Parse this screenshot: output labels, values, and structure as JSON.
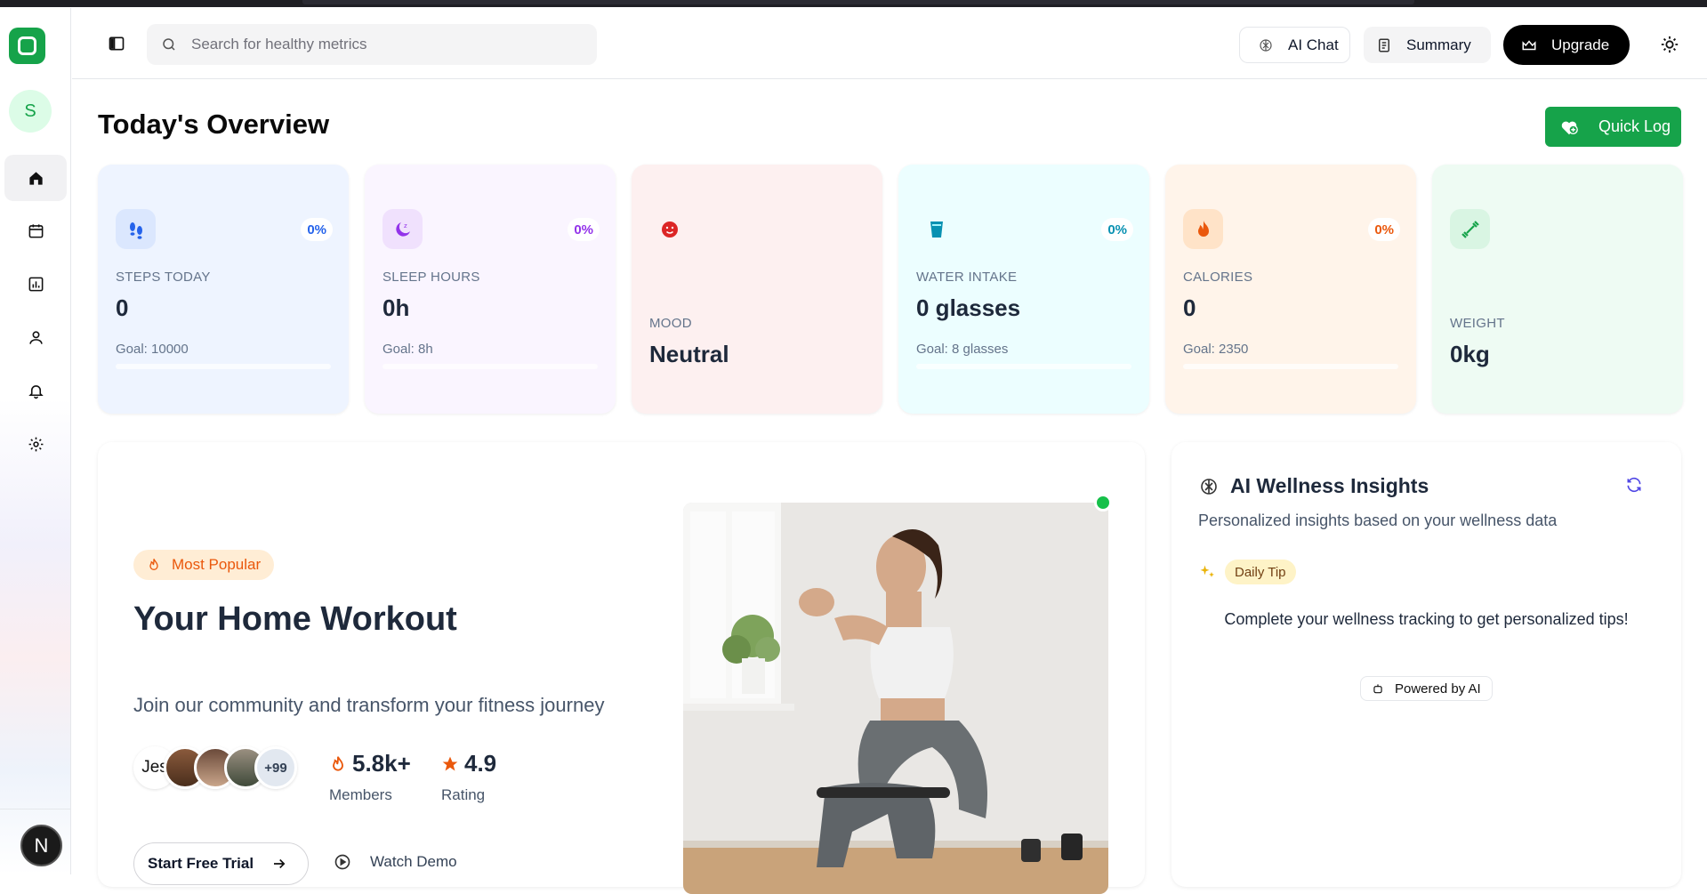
{
  "header": {
    "search_placeholder": "Search for healthy metrics",
    "ai_chat_label": "AI Chat",
    "summary_label": "Summary",
    "upgrade_label": "Upgrade"
  },
  "sidebar": {
    "user_initial": "S",
    "bottom_initial": "N",
    "items": [
      {
        "icon": "home-icon",
        "active": true
      },
      {
        "icon": "calendar-icon",
        "active": false
      },
      {
        "icon": "bar-chart-icon",
        "active": false
      },
      {
        "icon": "user-icon",
        "active": false
      },
      {
        "icon": "bell-icon",
        "active": false
      },
      {
        "icon": "gear-icon",
        "active": false
      }
    ]
  },
  "overview": {
    "title": "Today's Overview",
    "quick_log_label": "Quick Log",
    "cards": [
      {
        "key": "steps",
        "label": "STEPS TODAY",
        "value": "0",
        "goal": "Goal: 10000",
        "pct": "0%",
        "bg": "#eef4ff",
        "accent": "#2563eb",
        "icon": "footprints-icon"
      },
      {
        "key": "sleep",
        "label": "SLEEP HOURS",
        "value": "0h",
        "goal": "Goal: 8h",
        "pct": "0%",
        "bg": "#faf5ff",
        "accent": "#9333ea",
        "icon": "moon-icon"
      },
      {
        "key": "mood",
        "label": "MOOD",
        "value": "Neutral",
        "bg": "#fdf0f0",
        "accent": "#dc2626",
        "icon": "smiley-icon"
      },
      {
        "key": "water",
        "label": "WATER INTAKE",
        "value": "0 glasses",
        "goal": "Goal: 8 glasses",
        "pct": "0%",
        "bg": "#ecfeff",
        "accent": "#0891b2",
        "icon": "glass-icon"
      },
      {
        "key": "calories",
        "label": "CALORIES",
        "value": "0",
        "goal": "Goal: 2350",
        "pct": "0%",
        "bg": "#fff4ea",
        "accent": "#ea580c",
        "icon": "flame-icon"
      },
      {
        "key": "weight",
        "label": "WEIGHT",
        "value": "0kg",
        "bg": "#eefbf3",
        "accent": "#16a34a",
        "icon": "dumbbell-icon"
      }
    ]
  },
  "workout": {
    "badge": "Most Popular",
    "title": "Your Home Workout",
    "subtitle": "Join our community and transform your fitness journey",
    "avatar_first": "Jes",
    "avatar_more": "+99",
    "members_value": "5.8k+",
    "members_label": "Members",
    "rating_value": "4.9",
    "rating_label": "Rating",
    "trial_label": "Start Free Trial",
    "demo_label": "Watch Demo"
  },
  "ai_insights": {
    "title": "AI Wellness Insights",
    "subtitle": "Personalized insights based on your wellness data",
    "tip_badge": "Daily Tip",
    "tip_text": "Complete your wellness tracking to get personalized tips!",
    "powered_label": "Powered by AI"
  }
}
